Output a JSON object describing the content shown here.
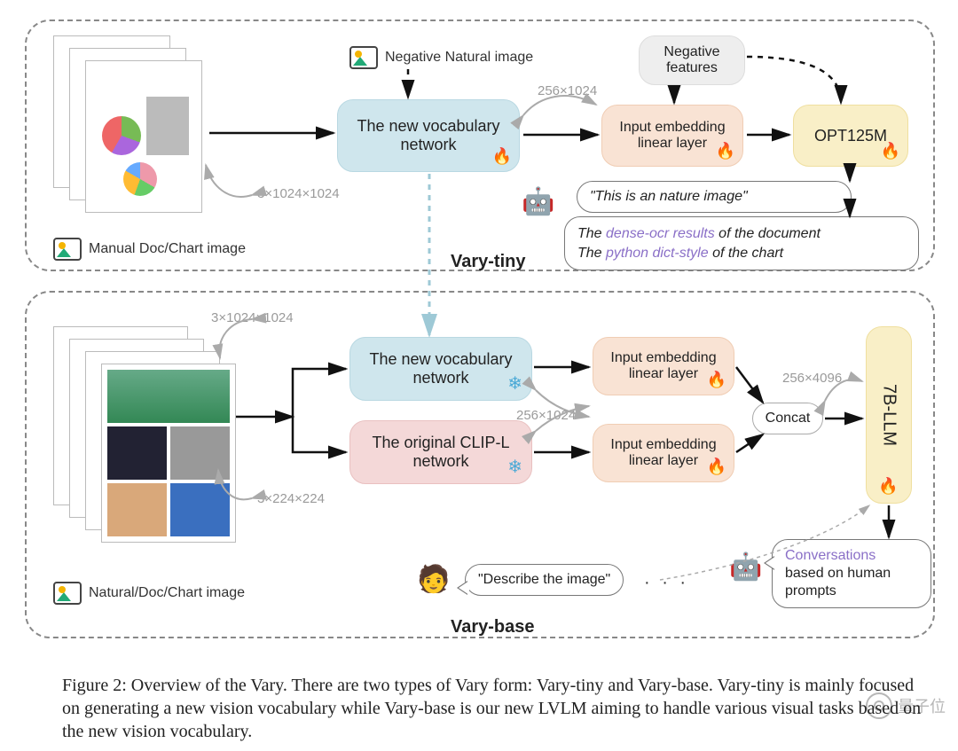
{
  "sections": {
    "tiny_label": "Vary-tiny",
    "base_label": "Vary-base"
  },
  "inputs": {
    "manual_label": "Manual Doc/Chart image",
    "neg_natural_label": "Negative Natural image",
    "natural_label": "Natural/Doc/Chart image"
  },
  "dims": {
    "d1": "3×1024×1024",
    "d2": "256×1024",
    "d1b": "3×1024×1024",
    "d2b": "256×1024",
    "d3": "3×224×224",
    "d4": "256×4096"
  },
  "blocks": {
    "new_vocab": "The new vocabulary network",
    "embed": "Input embedding linear layer",
    "opt": "OPT125M",
    "neg_feat": "Negative features",
    "new_vocab2": "The new vocabulary network",
    "clip": "The original CLIP-L network",
    "embed2a": "Input embedding linear layer",
    "embed2b": "Input embedding linear layer",
    "concat": "Concat",
    "llm": "7B-LLM"
  },
  "outputs": {
    "nature_quote": "\"This is an nature image\"",
    "dense_pre": "The ",
    "dense_hl": "dense-ocr results",
    "dense_post": " of the document",
    "dict_pre": "The ",
    "dict_hl": "python dict-style",
    "dict_post": " of the chart",
    "describe": "\"Describe the image\"",
    "dots": "· · ·",
    "conv_hl": "Conversations",
    "conv_rest": "based on human prompts"
  },
  "caption": "Figure 2: Overview of the Vary. There are two types of Vary form: Vary-tiny and Vary-base. Vary-tiny is mainly focused on generating a new vision vocabulary while Vary-base is our new LVLM aiming to handle various visual tasks based on the new vision vocabulary.",
  "watermark": "量子位"
}
